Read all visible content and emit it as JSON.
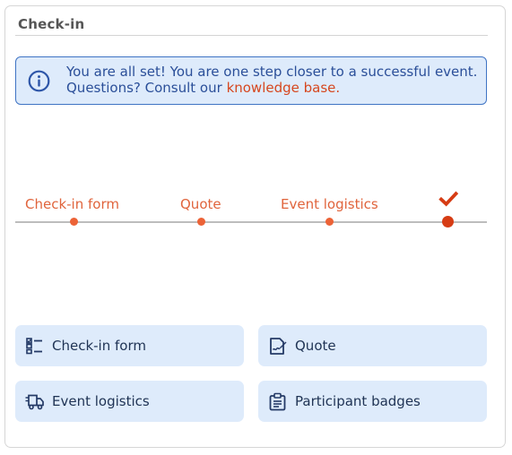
{
  "panel": {
    "title": "Check-in"
  },
  "notice": {
    "line1": "You are all set! You are one step closer to a successful event.",
    "line2_prefix": "Questions? Consult our ",
    "link_text": "knowledge base.",
    "icon": "info-circle-icon"
  },
  "progress": {
    "steps": [
      "Check-in form",
      "Quote",
      "Event logistics"
    ],
    "completed_icon": "checkmark-icon",
    "colors": {
      "step": "#e0643c",
      "final": "#d63c14",
      "line": "#bdbdbd"
    }
  },
  "actions": [
    {
      "label": "Check-in form",
      "icon": "checklist-icon"
    },
    {
      "label": "Quote",
      "icon": "signed-document-icon"
    },
    {
      "label": "Event logistics",
      "icon": "delivery-truck-icon"
    },
    {
      "label": "Participant badges",
      "icon": "badge-clipboard-icon"
    }
  ],
  "colors": {
    "accent_blue": "#3f74c4",
    "notice_bg": "#deebfb",
    "link": "#d6471f"
  }
}
